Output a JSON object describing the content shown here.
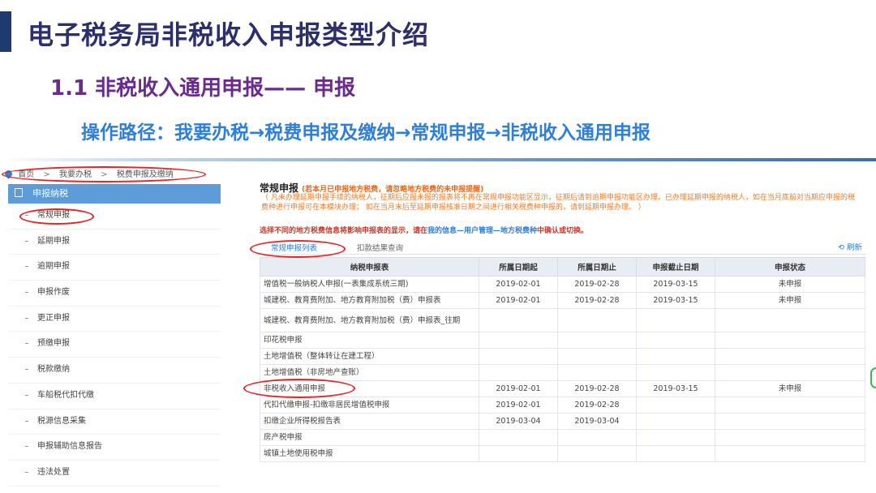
{
  "slide": {
    "title": "电子税务局非税收入申报类型介绍",
    "subtitle": "1.1 非税收入通用申报—— 申报",
    "path": "操作路径：我要办税→税费申报及缴纳→常规申报→非税收入通用申报"
  },
  "breadcrumb": {
    "home": "首页",
    "level1": "我要办税",
    "level2": "税费申报及缴纳",
    "sep": ">"
  },
  "sidebar": {
    "header": "申报纳税",
    "items": [
      {
        "label": "常规申报"
      },
      {
        "label": "延期申报"
      },
      {
        "label": "逾期申报"
      },
      {
        "label": "申报作废"
      },
      {
        "label": "更正申报"
      },
      {
        "label": "预缴申报"
      },
      {
        "label": "税款缴纳"
      },
      {
        "label": "车船税代扣代缴"
      },
      {
        "label": "税源信息采集"
      },
      {
        "label": "申报辅助信息报告"
      },
      {
        "label": "违法处置"
      }
    ]
  },
  "main": {
    "title": "常规申报",
    "hint": "(若本月已申报地方税费，请忽略地方税费的未申报提醒)",
    "notice": "（ 凡未办理延期申报手续的纳税人，征期后应报未报的报表将不再在常规申报功能区显示，征期后请到逾期申报功能区办理。已办理延期申报的纳税人，如在当月底前对当期应申报的税费种进行申报可在本模块办理； 如在当月末后至延期申报核准日期之间进行相关税费种申报的，请到延期申报办理。 ）",
    "warn_prefix": "选择不同的地方税费信息将影响申报表的显示，请在",
    "warn_link": "我的信息—用户管理—地方税费种",
    "warn_suffix": "中确认或切换。",
    "tabs": [
      {
        "label": "常规申报列表"
      },
      {
        "label": "扣款结果查询"
      }
    ],
    "refresh": "刷新",
    "columns": [
      "纳税申报表",
      "所属日期起",
      "所属日期止",
      "申报截止日期",
      "申报状态"
    ],
    "rows": [
      {
        "name": "增值税一般纳税人申报(一表集成系统三期)",
        "start": "2019-02-01",
        "end": "2019-02-28",
        "deadline": "2019-03-15",
        "status": "未申报"
      },
      {
        "name": "城建税、教育费附加、地方教育附加税（费）申报表",
        "start": "2019-02-01",
        "end": "2019-02-28",
        "deadline": "2019-03-15",
        "status": "未申报"
      },
      {
        "name": "城建税、教育费附加、地方教育附加税（费）申报表_往期",
        "start": "",
        "end": "",
        "deadline": "",
        "status": ""
      },
      {
        "name": "印花税申报",
        "start": "",
        "end": "",
        "deadline": "",
        "status": ""
      },
      {
        "name": "土地增值税（整体转让在建工程）",
        "start": "",
        "end": "",
        "deadline": "",
        "status": ""
      },
      {
        "name": "土地增值税（非房地产查账）",
        "start": "",
        "end": "",
        "deadline": "",
        "status": ""
      },
      {
        "name": "非税收入通用申报",
        "start": "2019-02-01",
        "end": "2019-02-28",
        "deadline": "2019-03-15",
        "status": "未申报"
      },
      {
        "name": "代扣代缴申报-扣缴非居民增值税申报",
        "start": "2019-02-01",
        "end": "2019-02-28",
        "deadline": "",
        "status": ""
      },
      {
        "name": "扣缴企业所得税报告表",
        "start": "2019-03-04",
        "end": "2019-03-04",
        "deadline": "",
        "status": ""
      },
      {
        "name": "房产税申报",
        "start": "",
        "end": "",
        "deadline": "",
        "status": ""
      },
      {
        "name": "城镇土地使用税申报",
        "start": "",
        "end": "",
        "deadline": "",
        "status": ""
      }
    ]
  },
  "colors": {
    "title": "#2b2f6b",
    "subtitle": "#6a2b8c",
    "path": "#2f7fd6",
    "highlight_ring": "#e0262b",
    "sidebar_header": "#5d9cd9"
  }
}
